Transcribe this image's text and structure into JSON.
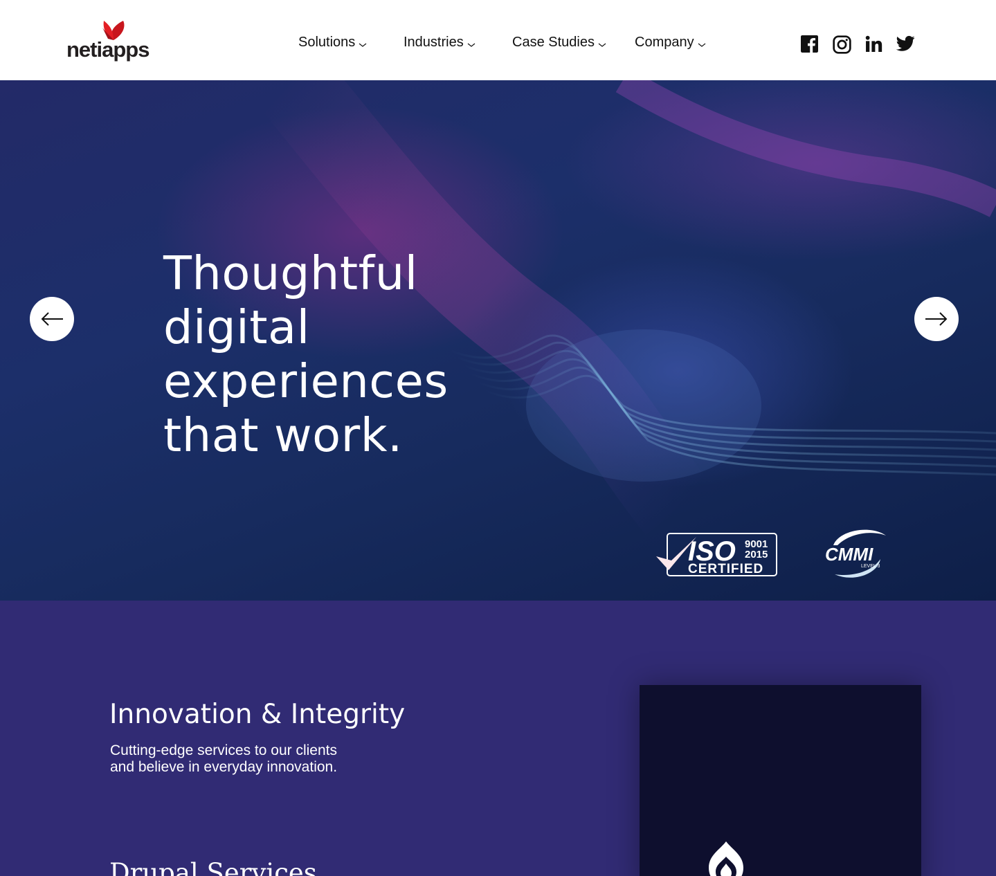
{
  "header": {
    "logo_text": "netiapps",
    "nav": [
      {
        "label": "Solutions"
      },
      {
        "label": "Industries"
      },
      {
        "label": "Case Studies"
      },
      {
        "label": "Company"
      }
    ],
    "social_icons": [
      "facebook-icon",
      "instagram-icon",
      "linkedin-icon",
      "twitter-icon"
    ]
  },
  "hero": {
    "title": "Thoughtful digital experiences that work.",
    "badges": {
      "iso": {
        "main": "ISO",
        "line1": "9001",
        "line2": "2015",
        "sub": "CERTIFIED"
      },
      "cmmi": {
        "main": "CMMI",
        "sub": "LEVEL 3"
      }
    }
  },
  "section": {
    "heading": "Innovation & Integrity",
    "body": "Cutting-edge services to our clients and believe in everyday innovation.",
    "subheading": "Drupal Services"
  },
  "colors": {
    "brand_red": "#e31e24",
    "hero_bg": "#1b2a62",
    "section_bg": "#312b74",
    "card_bg": "#0e0f2e"
  }
}
